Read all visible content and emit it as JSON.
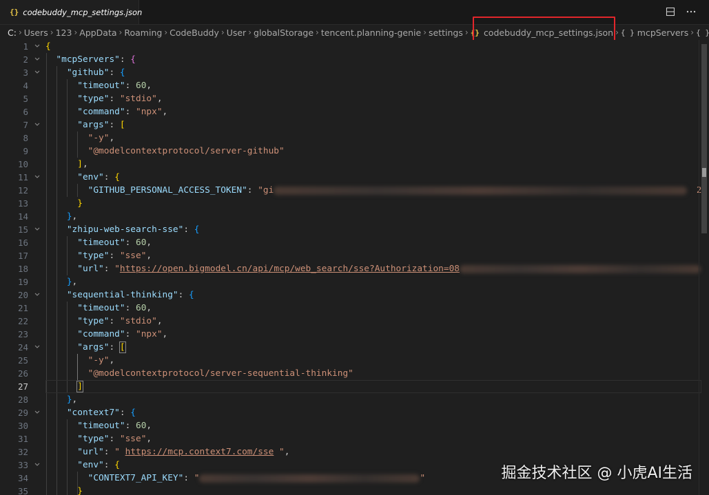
{
  "tab": {
    "icon": "{}",
    "label": "codebuddy_mcp_settings.json",
    "close_icon": "close-icon"
  },
  "breadcrumb": {
    "segments": [
      "C:",
      "Users",
      "123",
      "AppData",
      "Roaming",
      "CodeBuddy",
      "User",
      "globalStorage",
      "tencent.planning-genie",
      "settings"
    ],
    "file": "codebuddy_mcp_settings.json",
    "file_icon": "{}",
    "symbol": "mcpServers",
    "symbol_icon": "{ }",
    "trailing_icon": "{ }"
  },
  "editor": {
    "active_line": 27,
    "lines": [
      {
        "n": "1"
      },
      {
        "n": "2"
      },
      {
        "n": "3"
      },
      {
        "n": "4"
      },
      {
        "n": "5"
      },
      {
        "n": "6"
      },
      {
        "n": "7"
      },
      {
        "n": "8"
      },
      {
        "n": "9"
      },
      {
        "n": "10"
      },
      {
        "n": "11"
      },
      {
        "n": "12"
      },
      {
        "n": "13"
      },
      {
        "n": "14"
      },
      {
        "n": "15"
      },
      {
        "n": "16"
      },
      {
        "n": "17"
      },
      {
        "n": "18"
      },
      {
        "n": "19"
      },
      {
        "n": "20"
      },
      {
        "n": "21"
      },
      {
        "n": "22"
      },
      {
        "n": "23"
      },
      {
        "n": "24"
      },
      {
        "n": "25"
      },
      {
        "n": "26"
      },
      {
        "n": "27"
      },
      {
        "n": "28"
      },
      {
        "n": "29"
      },
      {
        "n": "30"
      },
      {
        "n": "31"
      },
      {
        "n": "32"
      },
      {
        "n": "33"
      },
      {
        "n": "34"
      },
      {
        "n": "35"
      }
    ],
    "text": {
      "mcpServers": "\"mcpServers\"",
      "github": "\"github\"",
      "timeout": "\"timeout\"",
      "type": "\"type\"",
      "command": "\"command\"",
      "args": "\"args\"",
      "env": "\"env\"",
      "url": "\"url\"",
      "v60": "60",
      "stdio": "\"stdio\"",
      "npx": "\"npx\"",
      "sse": "\"sse\"",
      "dash_y": "\"-y\"",
      "server_github": "\"@modelcontextprotocol/server-github\"",
      "github_token_key": "\"GITHUB_PERSONAL_ACCESS_TOKEN\"",
      "github_token_prefix": "\"gi",
      "zhipu": "\"zhipu-web-search-sse\"",
      "zhipu_url_quote": "\"",
      "zhipu_url": "https://open.bigmodel.cn/api/mcp/web_search/sse?Authorization=08",
      "seq": "\"sequential-thinking\"",
      "server_seq": "\"@modelcontextprotocol/server-sequential-thinking\"",
      "context7": "\"context7\"",
      "ctx_url_open": "\" ",
      "ctx_url": "https://mcp.context7.com/sse",
      "ctx_url_close": " \"",
      "ctx_key": "\"CONTEXT7_API_KEY\"",
      "ctx_key_prefix": "\"",
      "ctx_key_suffix": "\"",
      "overflow_mark": "2"
    }
  },
  "watermark": "掘金技术社区 @ 小虎AI生活",
  "colors": {
    "key": "#9cdcfe",
    "string": "#ce9178",
    "number": "#b5cea8",
    "bracket1": "#ffd700",
    "bracket2": "#da70d6",
    "bracket3": "#179fff",
    "highlight_box": "#e3262b"
  }
}
